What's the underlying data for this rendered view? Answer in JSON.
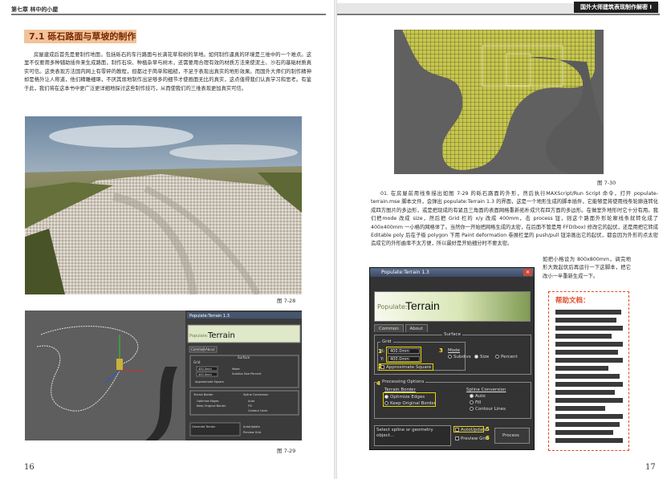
{
  "left_page": {
    "header": "第七章 林中的小屋",
    "section_title": "7.1 砾石路面与草坡的制作",
    "paragraph": "房屋建成后首先是要制作地面，包括砾石的车行路面与长满花草和树的草地。如何制作逼真的环境是三维中的一个难点。这里不仅要用多种辅助插件来生成路面，制作石块、种植杂草与树木，还需要用合理有效的材质方法来使泥土、沙石的基础材质真实可信。这类表现方法国内网上有零碎的教程，但都过于简单和粗糙，不足于表现出真实的地形效果。而国外大师们的制作精神却是格外让人称道，他们精雕细琢，不厌其烦地制作出足够多的细节才使画面无比的真实，这点值得我们认真学习和思考。有鉴于此，我们将在这本书中更广泛更详细地探讨这些制作技巧，从而使我们的三维表现更加真实可信。",
    "figure1_caption": "图 7-28",
    "figure2_caption": "图 7-29",
    "page_number": "16",
    "fig2_ui": {
      "title": "Populate:Terrain 1.3",
      "logo_prefix": "Populate:",
      "logo_main": "Terrain",
      "tabs": [
        "Common",
        "About"
      ],
      "surface": "Surface",
      "grid": "Grid",
      "x_value": "400.0mm",
      "y_value": "400.0mm",
      "approx": "Approximate Square",
      "terrain_border": "Terrain Border",
      "spline_conv": "Spline Conversion",
      "footer": "Generate Terrain"
    }
  },
  "right_page": {
    "header": "国外大师建筑表现制作解密 I",
    "figure_caption": "图 7-30",
    "paragraph": "01. 在房屋前用线条描出如图 7-29 的砾石路面的外形，然后执行MAXScript/Run Script 命令，打开 populate-terrain.mse 脚本文件，会弹出 populate:Terrain 1.3 的界面，这是一个地形生成的脚本插件，它能够是将使用线条轮廓连转化成四方图片的多边形，或是把现成的有紧且三角面的表面网格重新拓朴成只有四方面的多边形。在做室外地形时它十分有用。我们把mode 改成 size，然后把 Grid 栏的 x/y 改成 400mm，击 process 钮，则这个路面外形轮廓线条就转化成了 400x400mm 一小格的网格体了。当然你一开始把网格生成的太密，在后面不管是用 FFD(box) 修改它的起伏，还是用把它转成 Editable poly 后在子级 polygon 下用 Paint deformation 卷展栏里的 push/pull 钮涂画出它的起伏，都会因为外形的点太密造成它的外形曲率不太方便，所以最好是开始细分时不要太密。",
    "side_paragraph": "如把小格设为 800x800mm，调完地形大致起伏后再运行一下这脚本，把它改小一半重新生成一下。",
    "page_number": "17",
    "help_title": "帮助文档：",
    "dialog": {
      "title": "Populate:Terrain 1.3",
      "logo_prefix": "Populate:",
      "logo_main": "Terrain",
      "tabs": [
        "Common",
        "About"
      ],
      "surface": "Surface",
      "grid": "Grid",
      "x_label": "X:",
      "x_value": "400.0mm",
      "y_label": "Y:",
      "y_value": "400.0mm",
      "mode_label": "Mode",
      "mode_options": [
        "Subdivs",
        "Size",
        "Percent"
      ],
      "approx": "Approximate Square",
      "proc_options": "Processing Options",
      "terrain_border": "Terrain Border",
      "border_options": [
        "Optimize Edges",
        "Keep Original Border"
      ],
      "spline_conv": "Spline Conversion",
      "spline_options": [
        "Auto",
        "Fill",
        "Contour Lines"
      ],
      "status": "Select spline or geometry object...",
      "autoupdate": "AutoUpdate",
      "preview": "Preview Grid",
      "process": "Process",
      "markers": [
        "1",
        "2",
        "3",
        "4",
        "5",
        "6"
      ]
    }
  }
}
